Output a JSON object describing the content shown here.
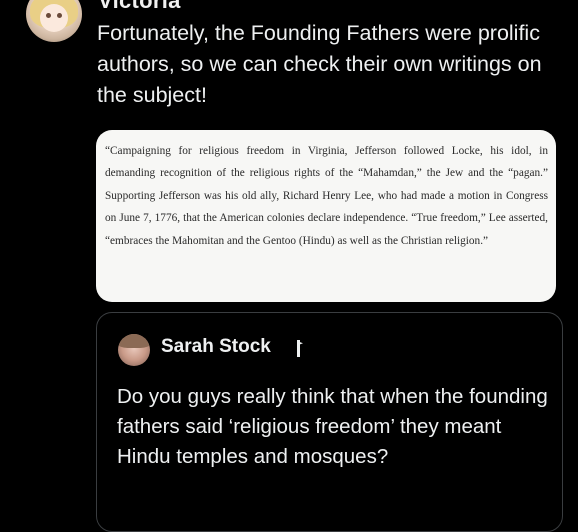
{
  "main_tweet": {
    "author_name": "Victoria",
    "avatar_icon": "anime-avatar-icon",
    "text": "Fortunately, the Founding Fathers were prolific authors, so we can check their own writings on the subject!",
    "attached_image_text": "“Campaigning for religious freedom in Virginia, Jefferson followed Locke, his idol, in demanding recognition of the religious rights of the “Mahamdan,” the Jew and the “pagan.” Supporting Jefferson was his old ally, Richard Henry Lee, who had made a motion in Congress on June 7, 1776, that the American colonies declare independence. “True freedom,” Lee asserted, “embraces the Mahomitan and the Gentoo (Hindu) as well as the Christian religion.”"
  },
  "quoted_tweet": {
    "author_name": "Sarah Stock",
    "badge_icon": "flag-icon",
    "text": "Do you guys really think that when the founding fathers said ‘religious freedom’ they meant Hindu temples and mosques?"
  },
  "colors": {
    "background": "#000000",
    "text": "#e7e9ea",
    "card_border": "#3a3d40",
    "quote_image_bg": "#f7f7f5"
  }
}
